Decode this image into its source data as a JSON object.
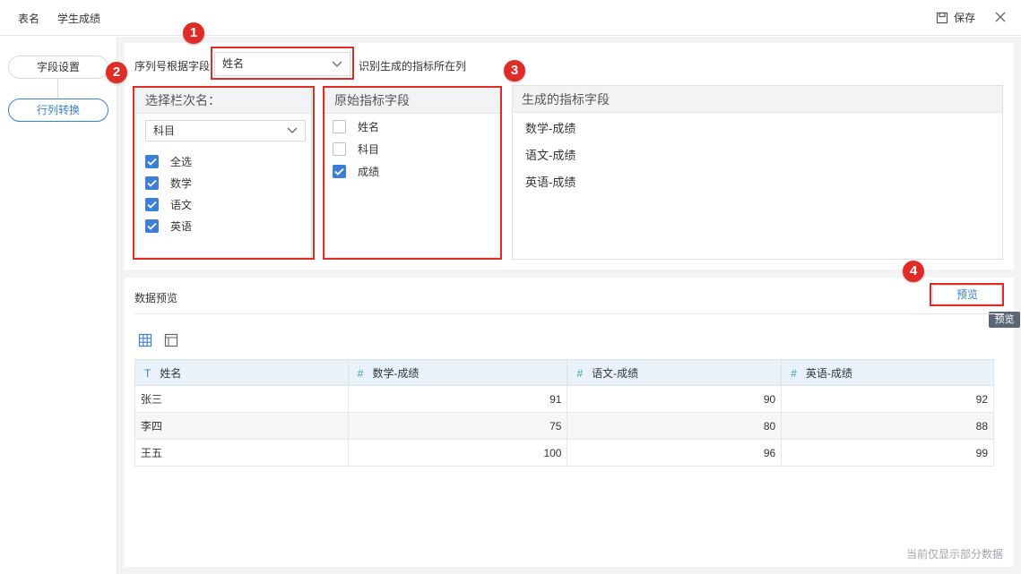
{
  "topbar": {
    "table_label": "表名",
    "table_name": "学生成绩",
    "save_label": "保存"
  },
  "steps": {
    "field_settings": "字段设置",
    "row_col_transform": "行列转换"
  },
  "config": {
    "serial_label": "序列号根据字段",
    "serial_value": "姓名",
    "serial_suffix": "识别生成的指标所在列"
  },
  "badges": [
    "1",
    "2",
    "3",
    "4"
  ],
  "column_select": {
    "title": "选择栏次名：",
    "field_value": "科目",
    "items": [
      {
        "label": "全选",
        "checked": true
      },
      {
        "label": "数学",
        "checked": true
      },
      {
        "label": "语文",
        "checked": true
      },
      {
        "label": "英语",
        "checked": true
      }
    ]
  },
  "source_fields": {
    "title": "原始指标字段",
    "items": [
      {
        "label": "姓名",
        "checked": false
      },
      {
        "label": "科目",
        "checked": false
      },
      {
        "label": "成绩",
        "checked": true
      }
    ]
  },
  "generated_fields": {
    "title": "生成的指标字段",
    "items": [
      "数学-成绩",
      "语文-成绩",
      "英语-成绩"
    ]
  },
  "preview": {
    "title": "数据预览",
    "button_label": "预览",
    "tooltip": "预览",
    "footnote": "当前仅显示部分数据"
  },
  "table": {
    "columns": [
      {
        "type_icon": "T",
        "label": "姓名"
      },
      {
        "type_icon": "#",
        "label": "数学-成绩"
      },
      {
        "type_icon": "#",
        "label": "语文-成绩"
      },
      {
        "type_icon": "#",
        "label": "英语-成绩"
      }
    ],
    "rows": [
      [
        "张三",
        "91",
        "90",
        "92"
      ],
      [
        "李四",
        "75",
        "80",
        "88"
      ],
      [
        "王五",
        "100",
        "96",
        "99"
      ]
    ]
  },
  "colors": {
    "accent": "#3a7fd5",
    "annotation_red": "#e02b27",
    "numeric_type": "#3aa39b"
  }
}
